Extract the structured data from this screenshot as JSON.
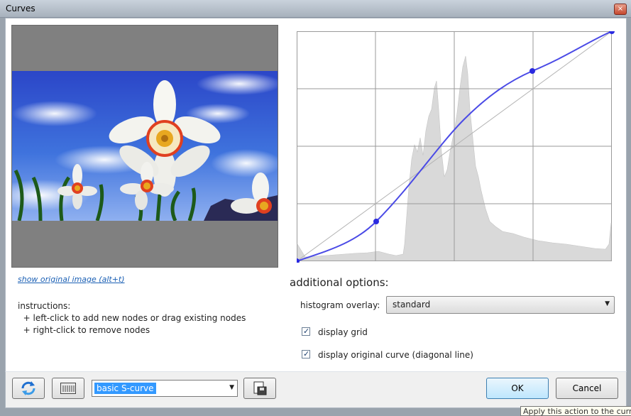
{
  "window": {
    "title": "Curves",
    "close_glyph": "×"
  },
  "preview": {
    "show_original_link": "show original image (alt+t)"
  },
  "instructions": {
    "heading": "instructions:",
    "lines": [
      "  + left-click to add new nodes or drag existing nodes",
      "  + right-click to remove nodes"
    ]
  },
  "options": {
    "heading": "additional options:",
    "histogram_overlay_label": "histogram overlay:",
    "histogram_overlay_value": "standard",
    "display_grid_label": "display grid",
    "display_grid_checked": true,
    "display_original_label": "display original curve (diagonal line)",
    "display_original_checked": true
  },
  "toolbar": {
    "preset_value": "basic S-curve",
    "ok_label": "OK",
    "cancel_label": "Cancel"
  },
  "tooltip": {
    "text": "Apply this action to the curre"
  },
  "colors": {
    "curve": "#4a4ae6",
    "grid": "#9a9a9a",
    "histogram": "#d9d9d9"
  },
  "icons": [
    "reset-icon",
    "histogram-icon",
    "save-icon",
    "close-icon",
    "chevron-down-icon"
  ]
}
